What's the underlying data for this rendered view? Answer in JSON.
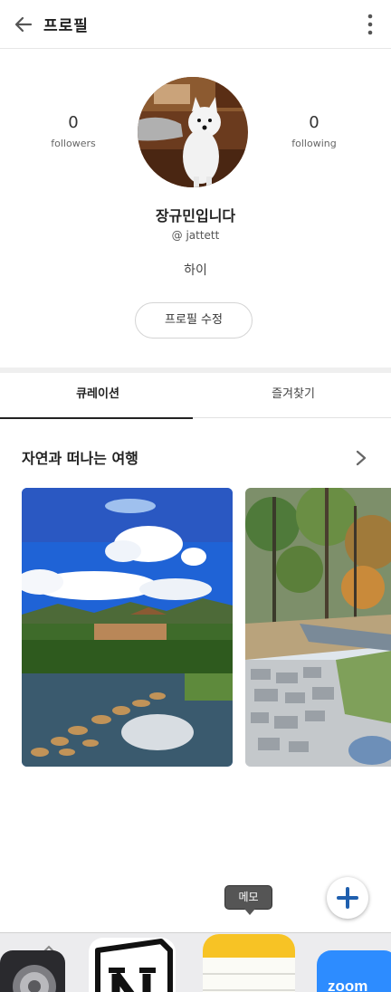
{
  "header": {
    "title": "프로필"
  },
  "profile": {
    "followers_count": "0",
    "followers_label": "followers",
    "following_count": "0",
    "following_label": "following",
    "name": "장규민입니다",
    "handle": "@ jattett",
    "bio": "하이",
    "edit_button": "프로필 수정"
  },
  "tabs": [
    {
      "label": "큐레이션",
      "active": true
    },
    {
      "label": "즐겨찾기",
      "active": false
    }
  ],
  "section": {
    "title": "자연과 떠나는 여행"
  },
  "tooltip": {
    "label": "메모"
  },
  "dock": {
    "zoom_label": "zoom"
  },
  "colors": {
    "accent": "#1f5fae",
    "zoom": "#2d8cff",
    "notes_yellow": "#f7c325"
  }
}
